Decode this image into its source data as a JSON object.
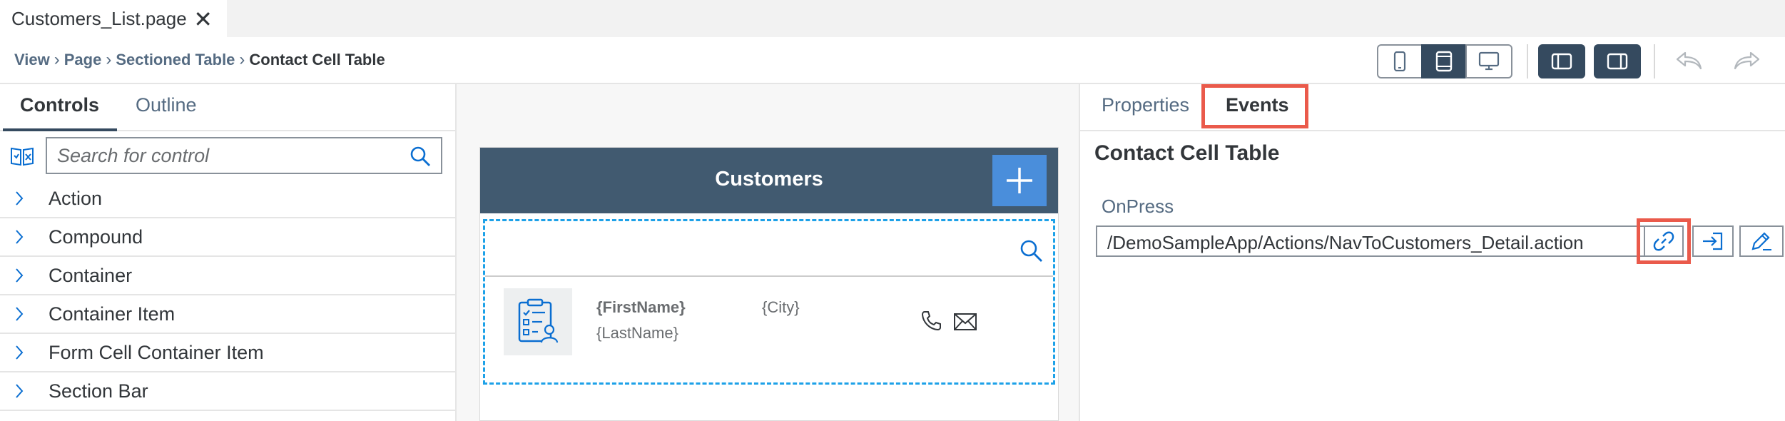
{
  "tab": {
    "title": "Customers_List.page",
    "close": "✕"
  },
  "breadcrumb": {
    "items": [
      "View",
      "Page",
      "Sectioned Table",
      "Contact Cell Table"
    ],
    "separator": "›"
  },
  "toolbar": {
    "icons": [
      "phone-preview-icon",
      "tablet-preview-icon",
      "desktop-preview-icon",
      "left-panel-toggle-icon",
      "right-panel-toggle-icon",
      "undo-icon",
      "redo-icon"
    ],
    "active_device": "tablet"
  },
  "left_panel": {
    "tabs": [
      {
        "label": "Controls",
        "active": true
      },
      {
        "label": "Outline",
        "active": false
      }
    ],
    "search_placeholder": "Search for control",
    "controls": [
      "Action",
      "Compound",
      "Container",
      "Container Item",
      "Form Cell Container Item",
      "Section Bar"
    ]
  },
  "canvas": {
    "nav_title": "Customers",
    "cell": {
      "first_name": "{FirstName}",
      "last_name": "{LastName}",
      "city": "{City}"
    }
  },
  "right_panel": {
    "tabs": [
      {
        "label": "Properties",
        "active": false
      },
      {
        "label": "Events",
        "active": true
      }
    ],
    "title": "Contact Cell Table",
    "onpress_label": "OnPress",
    "onpress_value": "/DemoSampleApp/Actions/NavToCustomers_Detail.action"
  },
  "colors": {
    "shell": "#354a5f",
    "nav_bar": "#415a70",
    "add_button": "#4a8edb",
    "selection": "#1da1e8",
    "highlight": "#ea5a4b"
  }
}
